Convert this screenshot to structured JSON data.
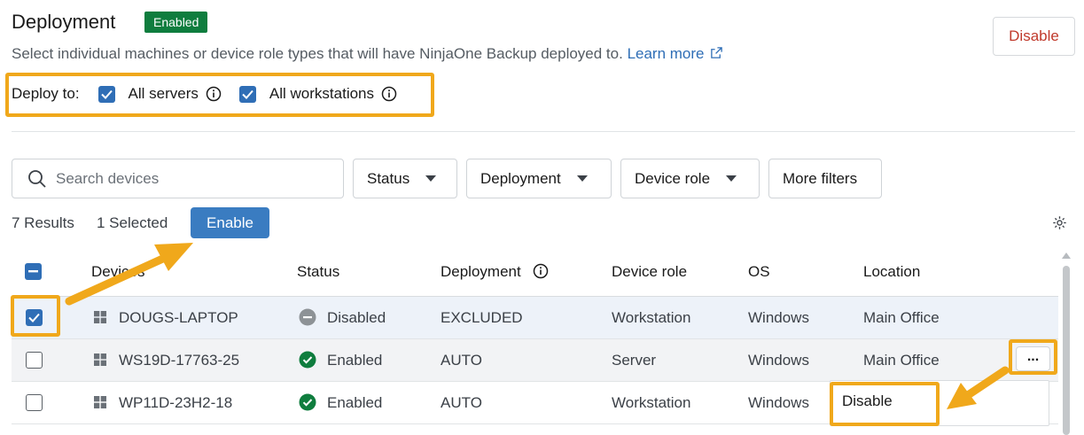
{
  "header": {
    "title": "Deployment",
    "badge": "Enabled",
    "description": "Select individual machines or device role types that will have NinjaOne Backup deployed to.",
    "learn_more": "Learn more",
    "disable_button": "Disable"
  },
  "deploy_to": {
    "label": "Deploy to:",
    "options": [
      {
        "label": "All servers",
        "checked": true
      },
      {
        "label": "All workstations",
        "checked": true
      }
    ]
  },
  "filters": {
    "search_placeholder": "Search devices",
    "status": "Status",
    "deployment": "Deployment",
    "device_role": "Device role",
    "more_filters": "More filters"
  },
  "results": {
    "count": "7 Results",
    "selected": "1 Selected",
    "enable_button": "Enable"
  },
  "table": {
    "columns": [
      "Devices",
      "Status",
      "Deployment",
      "Device role",
      "OS",
      "Location"
    ],
    "rows": [
      {
        "device": "DOUGS-LAPTOP",
        "status": "Disabled",
        "deployment": "EXCLUDED",
        "role": "Workstation",
        "os": "Windows",
        "location": "Main Office",
        "checked": true
      },
      {
        "device": "WS19D-17763-25",
        "status": "Enabled",
        "deployment": "AUTO",
        "role": "Server",
        "os": "Windows",
        "location": "Main Office",
        "checked": false
      },
      {
        "device": "WP11D-23H2-18",
        "status": "Enabled",
        "deployment": "AUTO",
        "role": "Workstation",
        "os": "Windows",
        "location": "",
        "checked": false
      }
    ],
    "row_actions_label": "...",
    "menu_item": "Disable"
  },
  "colors": {
    "accent": "#2f6eb6",
    "enabled_badge": "#0f7d3e",
    "disable_text": "#c0392b",
    "highlight": "#f0a81b",
    "status_enabled": "#0f7d3e",
    "status_disabled": "#8d9296"
  },
  "icons": [
    "external-link-icon",
    "info-icon",
    "search-icon",
    "caret-down-icon",
    "gear-icon",
    "windows-icon",
    "status-enabled-icon",
    "status-disabled-icon",
    "checkbox-icon",
    "arrow-annotation"
  ]
}
